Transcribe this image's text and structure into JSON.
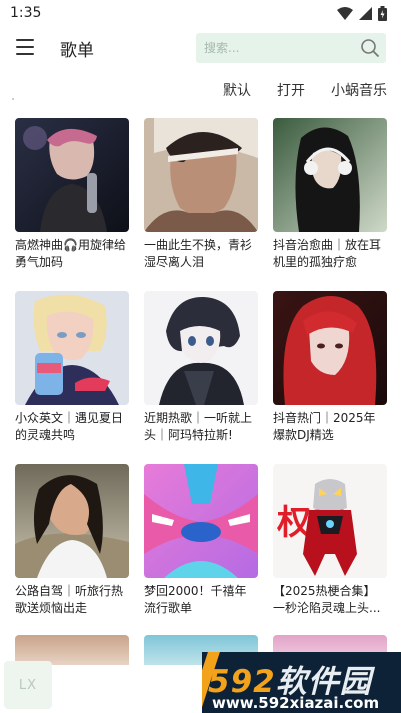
{
  "status_bar": {
    "time": "1:35"
  },
  "app_bar": {
    "title": "歌单",
    "search_placeholder": "搜索..."
  },
  "sort_options": [
    "默认",
    "打开",
    "小蜗音乐"
  ],
  "playlists": [
    {
      "title": "高燃神曲🎧用旋律给勇气加码"
    },
    {
      "title": "一曲此生不换，青衫湿尽离人泪"
    },
    {
      "title": "抖音治愈曲｜放在耳机里的孤独疗愈"
    },
    {
      "title": "小众英文｜遇见夏日的灵魂共鸣"
    },
    {
      "title": "近期热歌｜一听就上头｜阿玛特拉斯!"
    },
    {
      "title": "抖音热门｜2025年爆款DJ精选"
    },
    {
      "title": "公路自驾｜听旅行热歌送烦恼出走"
    },
    {
      "title": "梦回2000！千禧年流行歌单"
    },
    {
      "title": "【2025热梗合集】一秒沦陷灵魂上头..."
    }
  ],
  "cover_art": {
    "ultraman_text": "权威"
  },
  "floating_button": {
    "label": "LX"
  },
  "watermark": {
    "brand_number": "592",
    "brand_text": "软件园",
    "url": "www.592xiazai.com"
  },
  "colors": {
    "accent_search_bg": "#e5f3ea",
    "watermark_bg": "#0d2236",
    "watermark_orange": "#f3a21b"
  }
}
